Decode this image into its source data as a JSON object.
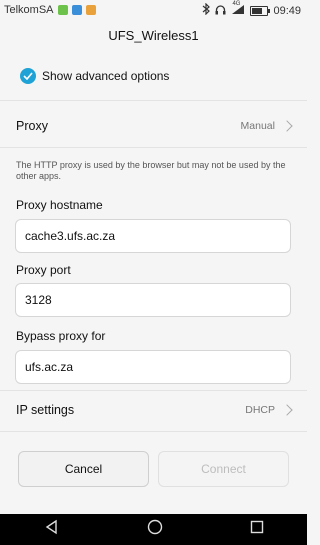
{
  "status_bar": {
    "carrier": "TelkomSA",
    "network_label": "4G",
    "time": "09:49",
    "battery_level": 0.7
  },
  "header": {
    "title": "UFS_Wireless1"
  },
  "advanced": {
    "label": "Show advanced options",
    "checked": true
  },
  "proxy": {
    "label": "Proxy",
    "value": "Manual"
  },
  "help_text": "The HTTP proxy is used by the browser but may not be used by the other apps.",
  "fields": {
    "hostname": {
      "label": "Proxy hostname",
      "value": "cache3.ufs.ac.za"
    },
    "port": {
      "label": "Proxy port",
      "value": "3128"
    },
    "bypass": {
      "label": "Bypass proxy for",
      "value": "ufs.ac.za"
    }
  },
  "ip_settings": {
    "label": "IP settings",
    "value": "DHCP"
  },
  "buttons": {
    "cancel": "Cancel",
    "connect": "Connect"
  },
  "colors": {
    "accent": "#1fa3d6",
    "disabled_text": "#bdbdbd"
  }
}
